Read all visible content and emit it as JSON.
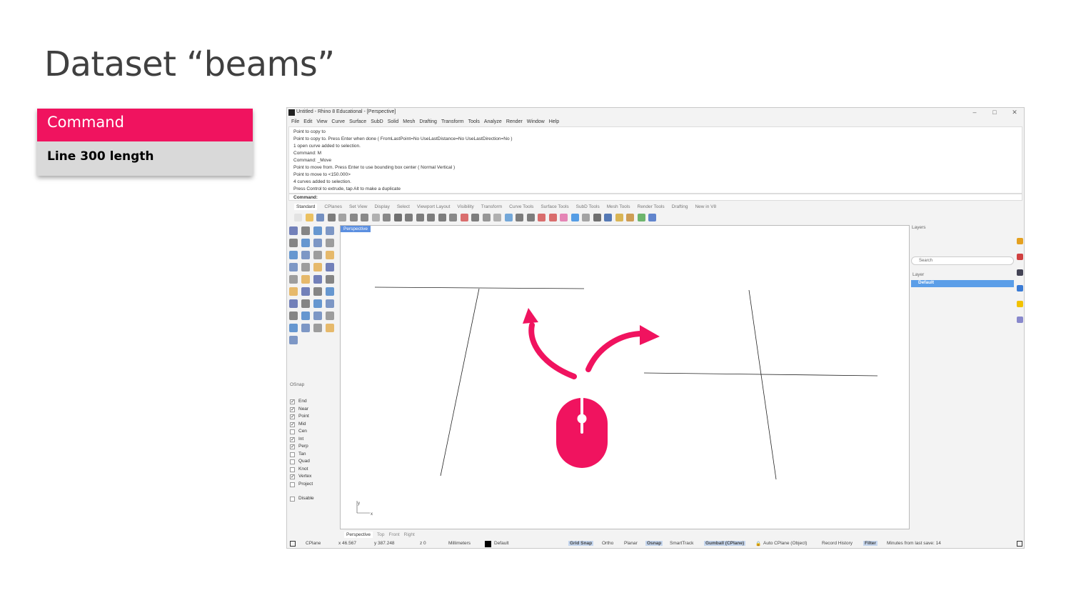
{
  "slide": {
    "title": "Dataset “beams”",
    "command_header": "Command",
    "command_value": "Line 300 length",
    "accent_color": "#f0135f"
  },
  "app": {
    "window_title": "Untitled - Rhino 8 Educational - [Perspective]",
    "menus": [
      "File",
      "Edit",
      "View",
      "Curve",
      "Surface",
      "SubD",
      "Solid",
      "Mesh",
      "Drafting",
      "Transform",
      "Tools",
      "Analyze",
      "Render",
      "Window",
      "Help"
    ],
    "command_history": [
      "Point to copy to",
      "Point to copy to. Press Enter when done ( FromLastPoint=No  UseLastDistance=No  UseLastDirection=No )",
      "1 open curve added to selection.",
      "Command: M",
      "Command: _Move",
      "Point to move from. Press Enter to use bounding box center ( Normal  Vertical )",
      "Point to move to <150.000>",
      "4 curves added to selection.",
      "Press Control to extrude, tap Alt to make a duplicate"
    ],
    "command_prompt": "Command:",
    "toolbar_tabs": [
      "Standard",
      "CPlanes",
      "Set View",
      "Display",
      "Select",
      "Viewport Layout",
      "Visibility",
      "Transform",
      "Curve Tools",
      "Surface Tools",
      "SubD Tools",
      "Mesh Tools",
      "Render Tools",
      "Drafting",
      "New in V8"
    ],
    "viewport_label": "Perspective",
    "view_tabs": [
      "Perspective",
      "Top",
      "Front",
      "Right"
    ],
    "axis_y": "y",
    "axis_x": "x",
    "osnap": {
      "title": "OSnap",
      "items": [
        {
          "label": "End",
          "checked": true
        },
        {
          "label": "Near",
          "checked": true
        },
        {
          "label": "Point",
          "checked": true
        },
        {
          "label": "Mid",
          "checked": true
        },
        {
          "label": "Cen",
          "checked": false
        },
        {
          "label": "Int",
          "checked": true
        },
        {
          "label": "Perp",
          "checked": true
        },
        {
          "label": "Tan",
          "checked": false
        },
        {
          "label": "Quad",
          "checked": false
        },
        {
          "label": "Knot",
          "checked": false
        },
        {
          "label": "Vertex",
          "checked": true
        },
        {
          "label": "Project",
          "checked": false
        }
      ],
      "disable_label": "Disable"
    },
    "layers": {
      "title": "Layers",
      "search_placeholder": "Search",
      "column_header": "Layer",
      "rows": [
        "Default"
      ]
    },
    "status": {
      "cplane": "CPlane",
      "x": "x 46.567",
      "y": "y 387.248",
      "z": "z 0",
      "units": "Millimeters",
      "layer": "Default",
      "grid_snap": "Grid Snap",
      "ortho": "Ortho",
      "planar": "Planar",
      "osnap": "Osnap",
      "smarttrack": "SmartTrack",
      "gumball": "Gumball (CPlane)",
      "auto_cplane": "Auto CPlane (Object)",
      "record_history": "Record History",
      "filter": "Filter",
      "last_save": "Minutes from last save: 14"
    }
  }
}
